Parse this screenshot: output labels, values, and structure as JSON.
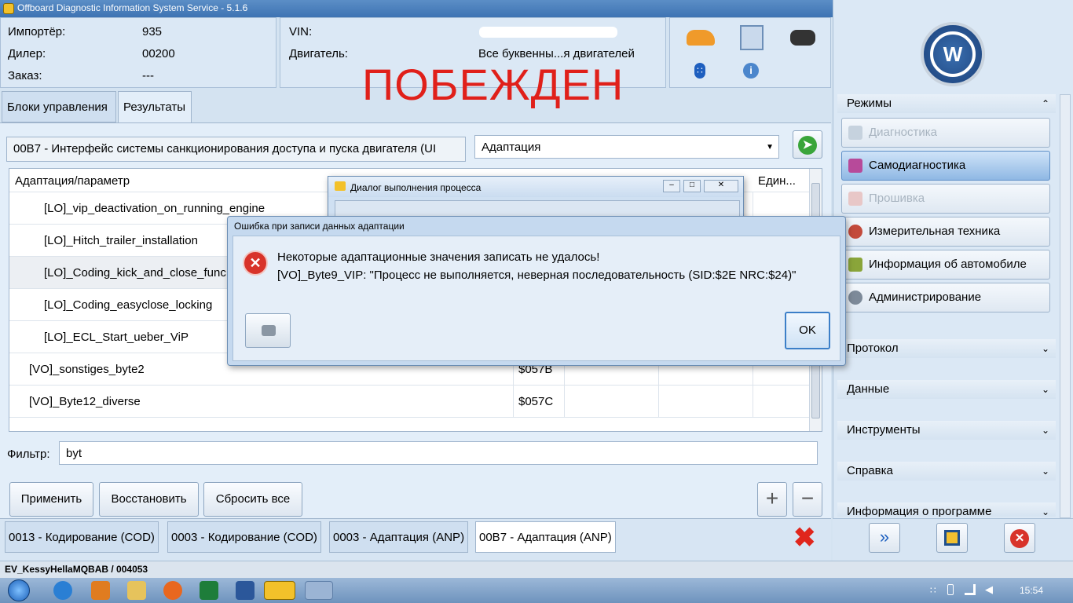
{
  "window": {
    "title": "Offboard Diagnostic Information System Service - 5.1.6"
  },
  "header": {
    "importer_label": "Импортёр:",
    "importer_value": "935",
    "dealer_label": "Дилер:",
    "dealer_value": "00200",
    "order_label": "Заказ:",
    "order_value": "---",
    "vin_label": "VIN:",
    "engine_label": "Двигатель:",
    "engine_value": "Все буквенны...я двигателей"
  },
  "overlay_text": "ПОБЕЖДЕН",
  "tabs": [
    {
      "label": "Блоки управления"
    },
    {
      "label": "Результаты"
    }
  ],
  "control_unit": {
    "value": "00B7 - Интерфейс системы санкционирования доступа и пуска двигателя  (UI"
  },
  "function_select": {
    "value": "Адаптация"
  },
  "table": {
    "headers": {
      "param": "Адаптация/параметр",
      "unit": "Един..."
    },
    "rows": [
      {
        "name": "[LO]_vip_deactivation_on_running_engine",
        "id": ""
      },
      {
        "name": "[LO]_Hitch_trailer_installation",
        "id": ""
      },
      {
        "name": "[LO]_Coding_kick_and_close_func",
        "id": ""
      },
      {
        "name": "[LO]_Coding_easyclose_locking",
        "id": ""
      },
      {
        "name": "[LO]_ECL_Start_ueber_ViP",
        "id": ""
      },
      {
        "name": "[VO]_sonstiges_byte2",
        "id": "$057B"
      },
      {
        "name": "[VO]_Byte12_diverse",
        "id": "$057C"
      }
    ]
  },
  "filter": {
    "label": "Фильтр:",
    "value": "byt"
  },
  "buttons": {
    "apply": "Применить",
    "restore": "Восстановить",
    "reset_all": "Сбросить все"
  },
  "bottom_tabs": [
    {
      "label": "0013 - Кодирование (COD)"
    },
    {
      "label": "0003 - Кодирование (COD)"
    },
    {
      "label": "0003 - Адаптация (ANP)"
    },
    {
      "label": "00B7 - Адаптация (ANP)"
    }
  ],
  "status_bar": {
    "text": "EV_KessyHellaMQBAB / 004053"
  },
  "right_panel": {
    "modes_title": "Режимы",
    "modes": [
      {
        "label": "Диагностика",
        "state": "disabled"
      },
      {
        "label": "Самодиагностика",
        "state": "active"
      },
      {
        "label": "Прошивка",
        "state": "disabled"
      },
      {
        "label": "Измерительная техника",
        "state": "normal"
      },
      {
        "label": "Информация об автомобиле",
        "state": "normal"
      },
      {
        "label": "Администрирование",
        "state": "normal"
      }
    ],
    "sections": [
      {
        "label": "Протокол"
      },
      {
        "label": "Данные"
      },
      {
        "label": "Инструменты"
      },
      {
        "label": "Справка"
      },
      {
        "label": "Информация о программе"
      }
    ]
  },
  "progress_dialog": {
    "title": "Диалог выполнения процесса"
  },
  "error_dialog": {
    "title": "Ошибка при записи данных адаптации",
    "line1": "Некоторые адаптационные значения записать не удалось!",
    "line2": "[VO]_Byte9_VIP: \"Процесс не выполняется, неверная последовательность (SID:$2E NRC:$24)\"",
    "ok": "OK"
  },
  "taskbar": {
    "time": "15:54"
  },
  "colors": {
    "accent": "#4a7ebb",
    "overlay_red": "#e0201a",
    "error_red": "#d8332a"
  }
}
